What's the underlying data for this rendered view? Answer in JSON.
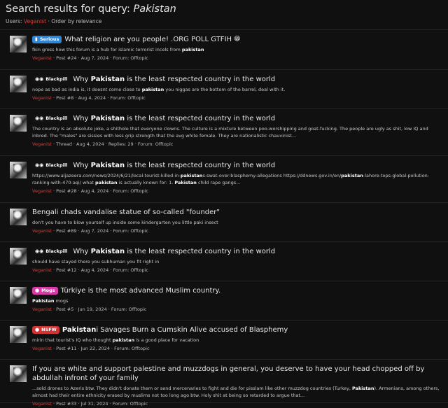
{
  "header": {
    "title_prefix": "Search results for query: ",
    "query": "Pakistan",
    "filter_label": "Users: ",
    "filter_user": "Veganist",
    "order_label": " · Order by relevance"
  },
  "results": [
    {
      "badge": {
        "label": "Serious",
        "style": "serious",
        "icon": "▮"
      },
      "title": [
        {
          "t": "What religion are you people! .ORG POLL GTFIH",
          "b": false
        }
      ],
      "emoji": "😁",
      "snippet": [
        {
          "t": "fkin gross how this forum is a hub for islamic terrorist incels from ",
          "b": false
        },
        {
          "t": "pakistan",
          "b": true
        }
      ],
      "meta": {
        "user": "Veganist",
        "rest": " · Post #24 · Aug 7, 2024 · Forum: Offtopic"
      }
    },
    {
      "badge": {
        "label": "Blackpill",
        "style": "blackpill",
        "icon": "◉◉"
      },
      "title": [
        {
          "t": "Why ",
          "b": false
        },
        {
          "t": "Pakistan",
          "b": true
        },
        {
          "t": " is the least respected country in the world",
          "b": false
        }
      ],
      "emoji": "",
      "snippet": [
        {
          "t": "nope as bad as india is, it doesnt come close to ",
          "b": false
        },
        {
          "t": "pakistan",
          "b": true
        },
        {
          "t": " you niggas are the bottom of the barrel, deal with it.",
          "b": false
        }
      ],
      "meta": {
        "user": "Veganist",
        "rest": " · Post #8 · Aug 4, 2024 · Forum: Offtopic"
      }
    },
    {
      "badge": {
        "label": "Blackpill",
        "style": "blackpill",
        "icon": "◉◉"
      },
      "title": [
        {
          "t": "Why ",
          "b": false
        },
        {
          "t": "Pakistan",
          "b": true
        },
        {
          "t": " is the least respected country in the world",
          "b": false
        }
      ],
      "emoji": "",
      "snippet": [
        {
          "t": "The country is an absolute joke, a shithole that everyone clowns. The culture is a mixture between poo-worshipping and goat-fucking. The people are ugly as shit, low IQ and inbred. The \"males\" are sissies with less grip strength that the avg white female. They are nationalistic chauvinist...",
          "b": false
        }
      ],
      "meta": {
        "user": "Veganist",
        "rest": " · Thread · Aug 4, 2024 · Replies: 29 · Forum: Offtopic"
      }
    },
    {
      "badge": {
        "label": "Blackpill",
        "style": "blackpill",
        "icon": "◉◉"
      },
      "title": [
        {
          "t": "Why ",
          "b": false
        },
        {
          "t": "Pakistan",
          "b": true
        },
        {
          "t": " is the least respected country in the world",
          "b": false
        }
      ],
      "emoji": "",
      "snippet": [
        {
          "t": "https://www.aljazeera.com/news/2024/6/21/local-tourist-killed-in-",
          "b": false
        },
        {
          "t": "pakistan",
          "b": true
        },
        {
          "t": "s-swat-over-blasphemy-allegations https://ddnews.gov.in/en/",
          "b": false
        },
        {
          "t": "pakistan",
          "b": true
        },
        {
          "t": "-lahore-tops-global-pollution-ranking-with-470-aqi/ what ",
          "b": false
        },
        {
          "t": "pakistan",
          "b": true
        },
        {
          "t": " is actually known for: 1. ",
          "b": false
        },
        {
          "t": "Pakistan",
          "b": true
        },
        {
          "t": " child rape gangs...",
          "b": false
        }
      ],
      "meta": {
        "user": "Veganist",
        "rest": " · Post #28 · Aug 4, 2024 · Forum: Offtopic"
      }
    },
    {
      "badge": null,
      "title": [
        {
          "t": "Bengali chads vandalise statue of so-called \"founder\"",
          "b": false
        }
      ],
      "emoji": "",
      "snippet": [
        {
          "t": "don't you have to blow yourself up inside some kindergarten you little paki insect",
          "b": false
        }
      ],
      "meta": {
        "user": "Veganist",
        "rest": " · Post #89 · Aug 7, 2024 · Forum: Offtopic"
      }
    },
    {
      "badge": {
        "label": "Blackpill",
        "style": "blackpill",
        "icon": "◉◉"
      },
      "title": [
        {
          "t": "Why ",
          "b": false
        },
        {
          "t": "Pakistan",
          "b": true
        },
        {
          "t": " is the least respected country in the world",
          "b": false
        }
      ],
      "emoji": "",
      "snippet": [
        {
          "t": "should have stayed there you subhuman you fit right in",
          "b": false
        }
      ],
      "meta": {
        "user": "Veganist",
        "rest": " · Post #12 · Aug 4, 2024 · Forum: Offtopic"
      }
    },
    {
      "badge": {
        "label": "Mogs",
        "style": "mogs",
        "icon": "●"
      },
      "title": [
        {
          "t": "Türkiye is the most advanced Muslim country.",
          "b": false
        }
      ],
      "emoji": "",
      "snippet": [
        {
          "t": "Pakistan",
          "b": true
        },
        {
          "t": " mogs",
          "b": false
        }
      ],
      "meta": {
        "user": "Veganist",
        "rest": " · Post #5 · Jun 19, 2024 · Forum: Offtopic"
      }
    },
    {
      "badge": {
        "label": "NSFW",
        "style": "nsfw",
        "icon": "●"
      },
      "title": [
        {
          "t": "Pakistan",
          "b": true
        },
        {
          "t": "i Savages Burn a Cumskin Alive accused of Blasphemy",
          "b": false
        }
      ],
      "emoji": "",
      "snippet": [
        {
          "t": "mirin that tourist's IQ who thought ",
          "b": false
        },
        {
          "t": "pakistan",
          "b": true
        },
        {
          "t": " is a good place for vacation",
          "b": false
        }
      ],
      "meta": {
        "user": "Veganist",
        "rest": " · Post #11 · Jun 22, 2024 · Forum: Offtopic"
      }
    },
    {
      "badge": null,
      "title": [
        {
          "t": "If you are white and support palestine and muzzdogs in general, you deserve to have your head chopped off by abdullah infront of your family",
          "b": false
        }
      ],
      "emoji": "",
      "snippet": [
        {
          "t": "...sold drones to Azeris btw. They didn't donate them or send mercenaries to fight and die for pisslam like other muzzdog countries (Turkey, ",
          "b": false
        },
        {
          "t": "Pakistan",
          "b": true
        },
        {
          "t": "). Armenians, among others, almost had their entire ethnicity erased by muslims not too long ago btw. Holy shit at being so retarded to argue that...",
          "b": false
        }
      ],
      "meta": {
        "user": "Veganist",
        "rest": " · Post #33 · Jul 31, 2024 · Forum: Offtopic"
      }
    }
  ]
}
